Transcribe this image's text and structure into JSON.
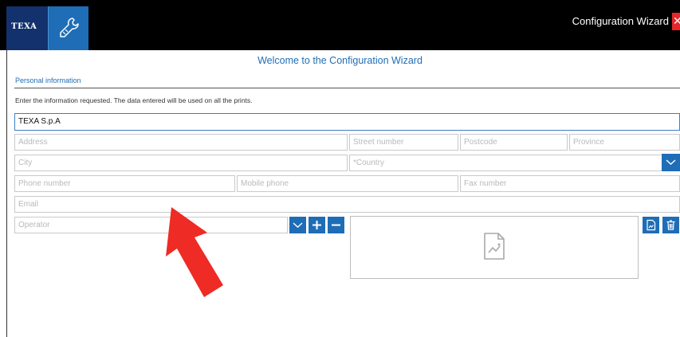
{
  "header": {
    "logo_text": "TEXA",
    "app_icon": "wrench-icon",
    "wizard_title": "Configuration Wizard",
    "close_glyph": "✕"
  },
  "main": {
    "welcome": "Welcome to the Configuration Wizard",
    "section_title": "Personal information",
    "instructions": "Enter the information requested. The data entered will be used on all the prints."
  },
  "form": {
    "company": {
      "value": "TEXA S.p.A"
    },
    "address": {
      "placeholder": "Address"
    },
    "street_number": {
      "placeholder": "Street number"
    },
    "postcode": {
      "placeholder": "Postcode"
    },
    "province": {
      "placeholder": "Province"
    },
    "city": {
      "placeholder": "City"
    },
    "country": {
      "placeholder": "*Country"
    },
    "phone": {
      "placeholder": "Phone number"
    },
    "mobile": {
      "placeholder": "Mobile phone"
    },
    "fax": {
      "placeholder": "Fax number"
    },
    "email": {
      "placeholder": "Email"
    },
    "operator": {
      "placeholder": "Operator"
    }
  },
  "icons": {
    "dropdown": "chevron-down-icon",
    "add": "plus-icon",
    "remove": "minus-icon",
    "load_image": "image-file-icon",
    "delete_image": "trash-icon",
    "image_placeholder": "image-placeholder-icon",
    "annotation": "red-arrow-icon"
  },
  "colors": {
    "brand_dark": "#12316d",
    "accent": "#1f6db6",
    "close": "#e3272b",
    "arrow": "#ee2b24"
  }
}
